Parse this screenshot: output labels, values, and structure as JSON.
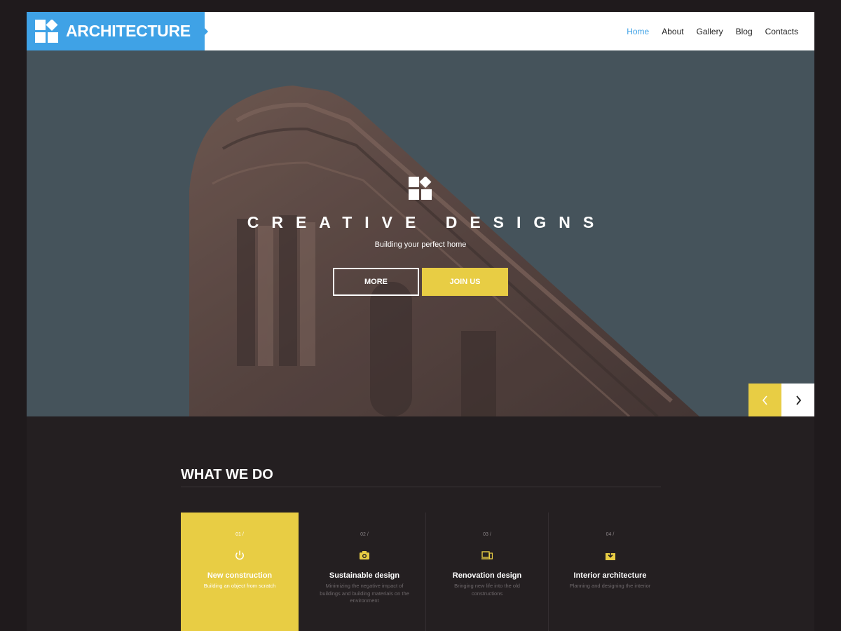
{
  "header": {
    "logo_text": "ARCHITECTURE",
    "nav": [
      {
        "label": "Home",
        "active": true
      },
      {
        "label": "About",
        "active": false
      },
      {
        "label": "Gallery",
        "active": false
      },
      {
        "label": "Blog",
        "active": false
      },
      {
        "label": "Contacts",
        "active": false
      }
    ]
  },
  "hero": {
    "title": "CREATIVE DESIGNS",
    "subtitle": "Building your perfect home",
    "more_label": "MORE",
    "join_label": "JOIN US",
    "prev_icon": "chevron-left-icon",
    "next_icon": "chevron-right-icon"
  },
  "what_we_do": {
    "title": "WHAT WE DO",
    "services": [
      {
        "num": "01 /",
        "icon": "power-icon",
        "title": "New construction",
        "desc": "Building an object from scratch",
        "active": true
      },
      {
        "num": "02 /",
        "icon": "camera-icon",
        "title": "Sustainable design",
        "desc": "Minimizing the negative impact of buildings and building materials on the environment",
        "active": false
      },
      {
        "num": "03 /",
        "icon": "devices-icon",
        "title": "Renovation design",
        "desc": "Bringing new life into the old constructions",
        "active": false
      },
      {
        "num": "04 /",
        "icon": "download-icon",
        "title": "Interior architecture",
        "desc": "Planning and designing the interior",
        "active": false
      }
    ]
  },
  "colors": {
    "accent_blue": "#3fa2e6",
    "accent_yellow": "#e8cd44",
    "dark_bg": "#241f21"
  }
}
